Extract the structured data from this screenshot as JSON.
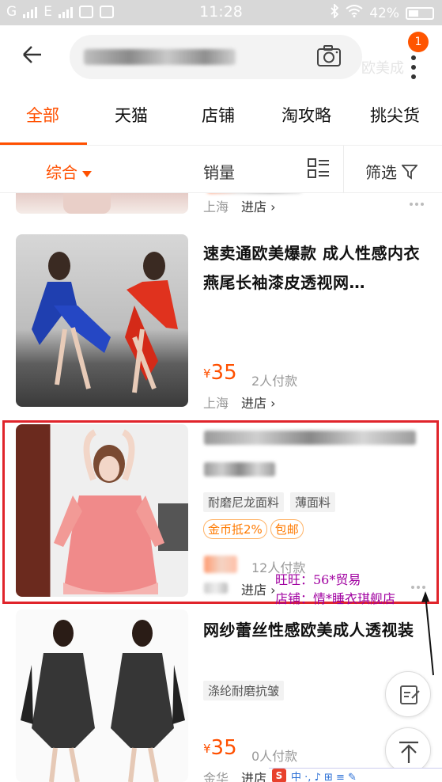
{
  "status_bar": {
    "carrier_left": "G",
    "network": "E",
    "time": "11:28",
    "battery": "42%"
  },
  "header": {
    "ghost_text": "欧美成",
    "cart_badge": "1"
  },
  "tabs": [
    {
      "label": "全部",
      "active": true
    },
    {
      "label": "天猫",
      "active": false
    },
    {
      "label": "店铺",
      "active": false
    },
    {
      "label": "淘攻略",
      "active": false
    },
    {
      "label": "挑尖货",
      "active": false
    }
  ],
  "sort": {
    "comprehensive": "综合",
    "sales": "销量",
    "filter": "筛选"
  },
  "items": [
    {
      "location": "上海",
      "shop_label": "进店",
      "chevron": "›"
    },
    {
      "title": "速卖通欧美爆款 成人性感内衣燕尾长袖漆皮透视网…",
      "price_symbol": "¥",
      "price": "35",
      "paid_count": "2人付款",
      "location": "上海",
      "shop_label": "进店",
      "chevron": "›"
    },
    {
      "tags": [
        "耐磨尼龙面料",
        "薄面料"
      ],
      "promo_tags": [
        "金币抵2%",
        "包邮"
      ],
      "paid_count": "12人付款",
      "shop_label": "进店",
      "chevron": "›"
    },
    {
      "title": "网纱蕾丝性感欧美成人透视装",
      "tags": [
        "涤纶耐磨抗皱"
      ],
      "price_symbol": "¥",
      "price": "35",
      "paid_count": "0人付款",
      "location": "金华",
      "shop_label": "进店",
      "chevron": "›"
    }
  ],
  "annotation": {
    "wangwang": "旺旺：56*贸易",
    "shop": "店铺：情*睡衣琪舰店"
  },
  "ime": {
    "logo": "S",
    "text": "中 ·, ♪ ⊞ ≡ ✎"
  },
  "colors": {
    "accent": "#ff5000",
    "highlight_border": "#e0242b",
    "annotation": "#a000a0"
  }
}
